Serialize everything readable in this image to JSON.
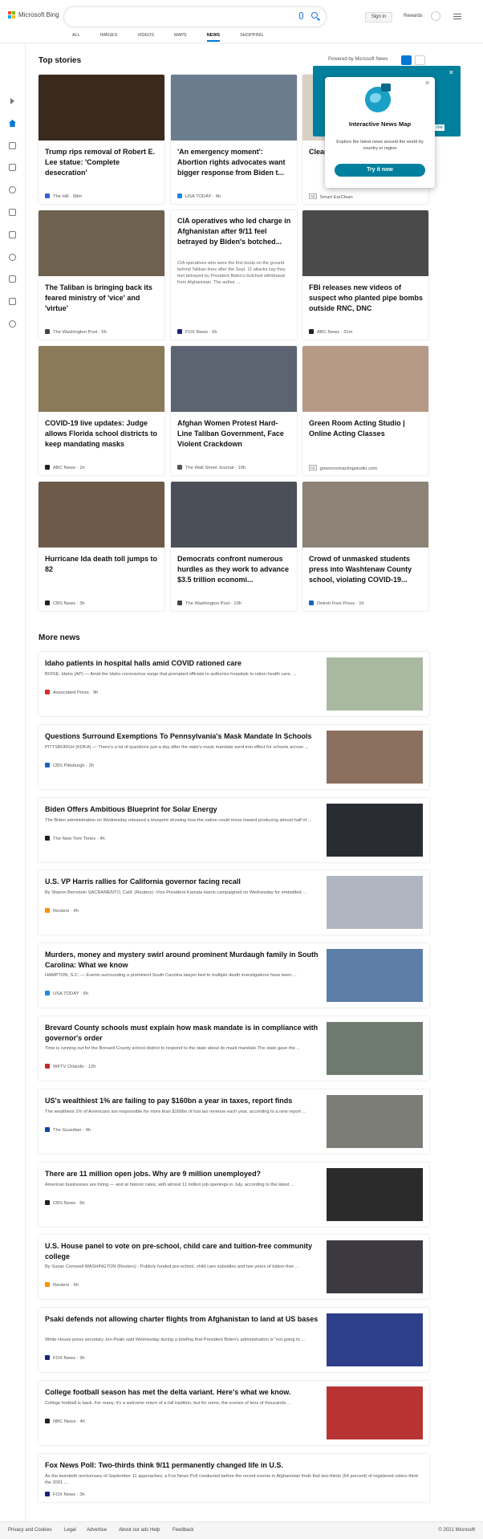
{
  "header": {
    "logo_text": "Microsoft Bing",
    "search_value": "",
    "signin_label": "Sign in",
    "rewards_label": "Rewards"
  },
  "nav": {
    "tabs": [
      "ALL",
      "IMAGES",
      "VIDEOS",
      "MAPS",
      "NEWS",
      "SHOPPING"
    ],
    "active": "NEWS"
  },
  "sidebar": {
    "icons": [
      "expand-icon",
      "home-icon",
      "tools-icon",
      "flag-icon",
      "location-icon",
      "world-icon",
      "technology-icon",
      "science-icon",
      "entertainment-icon",
      "government-icon",
      "money-icon"
    ]
  },
  "top": {
    "title": "Top stories",
    "powered": "Powered by Microsoft News"
  },
  "cards": [
    {
      "title": "Trump rips removal of Robert E. Lee statue: 'Complete desecration'",
      "source": "The Hill",
      "time": "58m",
      "icon_color": "#3b5bdb",
      "img": "#3a2a1e"
    },
    {
      "title": "'An emergency moment': Abortion rights advocates want bigger response from Biden t...",
      "source": "USA TODAY",
      "time": "4h",
      "icon_color": "#1e88e5",
      "img": "#6b7c8e"
    },
    {
      "title": "Clear... With...",
      "source": "Smart EarClean",
      "ad": "Ad",
      "img": "#d9d0c4"
    },
    {
      "title": "The Taliban is bringing back its feared ministry of 'vice' and 'virtue'",
      "source": "The Washington Post",
      "time": "5h",
      "icon_color": "#444",
      "img": "#6f6150"
    },
    {
      "title": "CIA operatives who led charge in Afghanistan after 9/11 feel betrayed by Biden's botched...",
      "snippet": "CIA operatives who were the first boots on the ground behind Taliban lines after the Sept. 11 attacks say they feel betrayed by President Biden's botched withdrawal from Afghanistan. The author ...",
      "source": "FOX News",
      "time": "5h",
      "icon_color": "#1a237e"
    },
    {
      "title": "FBI releases new videos of suspect who planted pipe bombs outside RNC, DNC",
      "source": "ABC News",
      "time": "31m",
      "icon_color": "#222",
      "img": "#4a4a4a"
    },
    {
      "title": "COVID-19 live updates: Judge allows Florida school districts to keep mandating masks",
      "source": "ABC News",
      "time": "1h",
      "icon_color": "#222",
      "img": "#8a7a5a"
    },
    {
      "title": "Afghan Women Protest Hard-Line Taliban Government, Face Violent Crackdown",
      "source": "The Wall Street Journal",
      "time": "10h",
      "icon_color": "#555",
      "img": "#5b6470"
    },
    {
      "title": "Green Room Acting Studio | Online Acting Classes",
      "source": "greenroomactingstudio.com",
      "ad": "Ad",
      "img": "#b79a86"
    },
    {
      "title": "Hurricane Ida death toll jumps to 82",
      "source": "CBS News",
      "time": "3h",
      "icon_color": "#222",
      "img": "#6e5a48"
    },
    {
      "title": "Democrats confront numerous hurdles as they work to advance $3.5 trillion economi...",
      "source": "The Washington Post",
      "time": "10h",
      "icon_color": "#444",
      "img": "#4b4f58"
    },
    {
      "title": "Crowd of unmasked students press into Washtenaw County school, violating COVID-19...",
      "source": "Detroit Free Press",
      "time": "1h",
      "icon_color": "#1565c0",
      "img": "#8c8276"
    }
  ],
  "more": {
    "title": "More news",
    "items": [
      {
        "title": "Idaho patients in hospital halls amid COVID rationed care",
        "snippet": "BOISE, Idaho (AP) — Amid the Idaho coronavirus surge that prompted officials to authorize hospitals to ration health care, ...",
        "source": "Associated Press",
        "time": "9h",
        "icon_color": "#d32f2f",
        "img": "#a9b8a0"
      },
      {
        "title": "Questions Surround Exemptions To Pennsylvania's Mask Mandate In Schools",
        "snippet": "PITTSBURGH (KDKA) — There's a lot of questions just a day after the state's mask mandate went into effect for schools across ...",
        "source": "CBS Pittsburgh",
        "time": "2h",
        "icon_color": "#1565c0",
        "img": "#8a6f5e"
      },
      {
        "title": "Biden Offers Ambitious Blueprint for Solar Energy",
        "snippet": "The Biden administration on Wednesday released a blueprint showing how the nation could move toward producing almost half of ...",
        "source": "The New York Times",
        "time": "4h",
        "icon_color": "#222",
        "img": "#2a2c33"
      },
      {
        "title": "U.S. VP Harris rallies for California governor facing recall",
        "snippet": "By Sharon Bernstein SACRAMENTO, Calif. (Reuters) -Vice President Kamala Harris campaigned on Wednesday for embattled ...",
        "source": "Reuters",
        "time": "4h",
        "icon_color": "#ff8f00",
        "img": "#b0b6bf"
      },
      {
        "title": "Murders, money and mystery swirl around prominent Murdaugh family in South Carolina: What we know",
        "snippet": "HAMPTON, S.C. — Events surrounding a prominent South Carolina lawyer tied to multiple death investigations have been ...",
        "source": "USA TODAY",
        "time": "6h",
        "icon_color": "#1e88e5",
        "img": "#5d7ea6"
      },
      {
        "title": "Brevard County schools must explain how mask mandate is in compliance with governor's order",
        "snippet": "Time is running out for the Brevard County school district to respond to the state about its mask mandate.The state gave the ...",
        "source": "WFTV Orlando",
        "time": "12h",
        "icon_color": "#c62828",
        "img": "#6f7a6e"
      },
      {
        "title": "US's wealthiest 1% are failing to pay $160bn a year in taxes, report finds",
        "snippet": "The wealthiest 1% of Americans are responsible for more than $160bn of lost tax revenue each year, according to a new report ...",
        "source": "The Guardian",
        "time": "4h",
        "icon_color": "#0d47a1",
        "img": "#7d7d78"
      },
      {
        "title": "There are 11 million open jobs. Why are 9 million unemployed?",
        "snippet": "American businesses are hiring — and at historic rates, with almost 11 million job openings in July, according to the latest ...",
        "source": "CBS News",
        "time": "5h",
        "icon_color": "#222",
        "img": "#2b2b2b"
      },
      {
        "title": "U.S. House panel to vote on pre-school, child care and tuition-free community college",
        "snippet": "By Susan Cornwell WASHINGTON (Reuters) - Publicly funded pre-school, child care subsidies and two years of tuition-free ...",
        "source": "Reuters",
        "time": "6h",
        "icon_color": "#ff8f00",
        "img": "#3c3a40"
      },
      {
        "title": "Psaki defends not allowing charter flights from Afghanistan to land at US bases",
        "snippet": "White House press secretary Jen Psaki said Wednesday during a briefing that President Biden's administration is \"not going to ...",
        "source": "FOX News",
        "time": "3h",
        "icon_color": "#1a237e",
        "img": "#2d3f8a"
      },
      {
        "title": "College football season has met the delta variant. Here's what we know.",
        "snippet": "College football is back. For many, it's a welcome return of a fall tradition, but for some, the scenes of tens of thousands ...",
        "source": "NBC News",
        "time": "4h",
        "icon_color": "#222",
        "img": "#b83434"
      },
      {
        "title": "Fox News Poll: Two-thirds think 9/11 permanently changed life in U.S.",
        "snippet": "As the twentieth anniversary of September 11 approaches, a Fox News Poll conducted before the recent events in Afghanistan finds that two-thirds (64 percent) of registered voters think the 2001 ...",
        "source": "FOX News",
        "time": "3h",
        "icon_color": "#1a237e"
      }
    ]
  },
  "popup": {
    "title": "Interactive News Map",
    "desc": "Explore the latest news around the world by country or region",
    "button": "Try it now",
    "behind_text": "es",
    "behind_btn": "ow"
  },
  "footer": {
    "links": [
      "Privacy and Cookies",
      "Legal",
      "Advertise",
      "About our ads",
      "Help",
      "Feedback"
    ],
    "copyright": "© 2021 Microsoft"
  }
}
